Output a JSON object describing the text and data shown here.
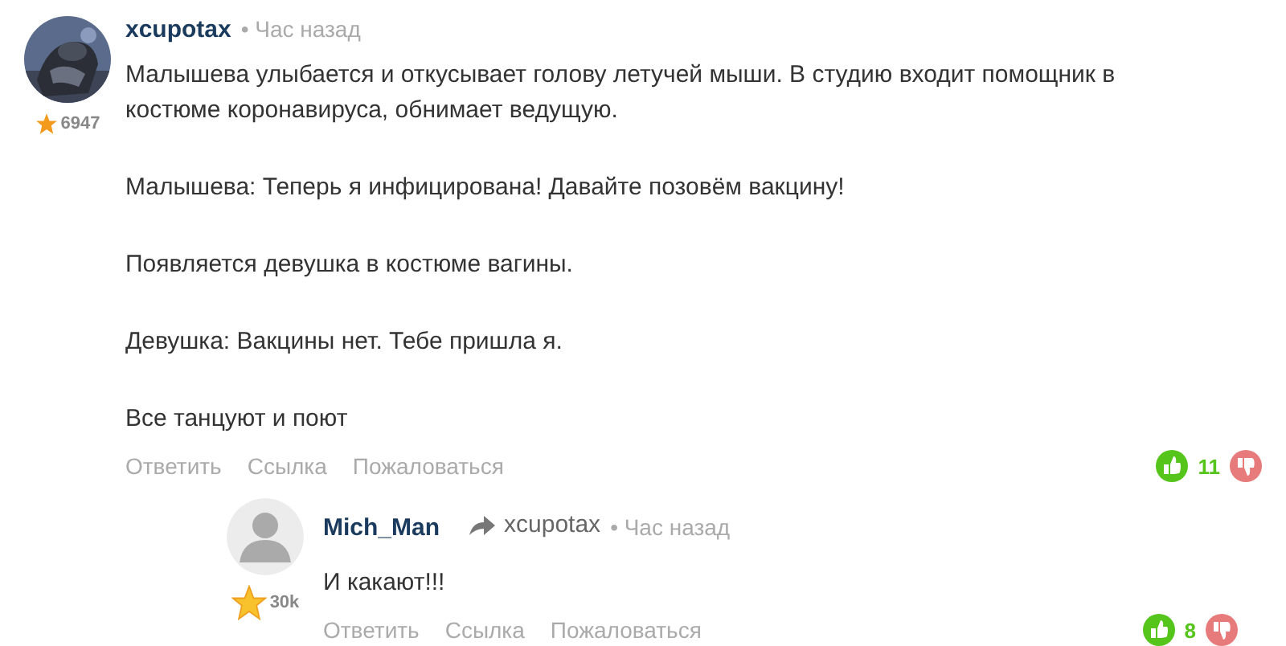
{
  "comments": [
    {
      "author": "xcupotax",
      "time": "• Час назад",
      "rating": "6947",
      "paragraphs": [
        "Малышева улыбается и откусывает голову летучей мыши. В студию входит помощник в костюме коронавируса, обнимает ведущую.",
        "Малышева: Теперь я инфицирована! Давайте позовём вакцину!",
        "Появляется девушка в костюме вагины.",
        "Девушка: Вакцины нет. Тебе пришла я.",
        "Все танцуют и поют"
      ],
      "actions": [
        "Ответить",
        "Ссылка",
        "Пожаловаться"
      ],
      "score": "11",
      "children": [
        {
          "author": "Mich_Man",
          "reply_to": "xcupotax",
          "time": "• Час назад",
          "avatar": {
            "kind": "default"
          },
          "rating": "30k",
          "paragraphs": [
            "И какают!!!"
          ],
          "actions": [
            "Ответить",
            "Ссылка",
            "Пожаловаться"
          ],
          "score": "8"
        }
      ]
    }
  ]
}
